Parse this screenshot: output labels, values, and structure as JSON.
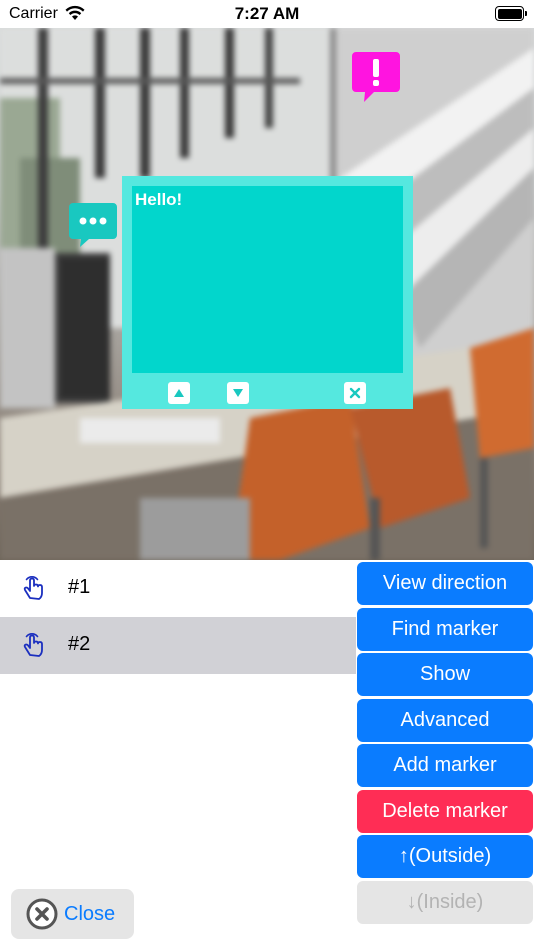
{
  "status_bar": {
    "carrier": "Carrier",
    "time": "7:27 AM"
  },
  "popup": {
    "text": "Hello!"
  },
  "markers": [
    {
      "label": "#1",
      "selected": false
    },
    {
      "label": "#2",
      "selected": true
    }
  ],
  "actions": {
    "view_direction": "View direction",
    "find_marker": "Find marker",
    "show": "Show",
    "advanced": "Advanced",
    "add_marker": "Add marker",
    "delete_marker": "Delete marker",
    "outside": "↑(Outside)",
    "inside": "↓(Inside)"
  },
  "close": {
    "label": "Close"
  },
  "colors": {
    "accent": "#0a7cff",
    "danger": "#ff2d55",
    "popup_bg": "#55e8df",
    "popup_text_bg": "#02d6cc",
    "marker_magenta": "#ff14e0",
    "marker_teal": "#19c8c0"
  }
}
